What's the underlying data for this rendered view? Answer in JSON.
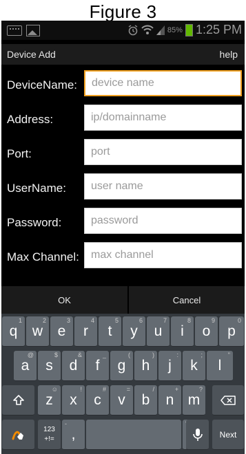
{
  "caption": "Figure 3",
  "status_bar": {
    "battery_percent": "85%",
    "time": "1:25 PM"
  },
  "app_bar": {
    "title": "Device Add",
    "help_label": "help"
  },
  "form": {
    "fields": [
      {
        "label": "DeviceName:",
        "placeholder": "device name"
      },
      {
        "label": "Address:",
        "placeholder": "ip/domainname"
      },
      {
        "label": "Port:",
        "placeholder": "port"
      },
      {
        "label": "UserName:",
        "placeholder": "user name"
      },
      {
        "label": "Password:",
        "placeholder": "password"
      },
      {
        "label": "Max Channel:",
        "placeholder": "max channel"
      }
    ]
  },
  "buttons": {
    "ok": "OK",
    "cancel": "Cancel"
  },
  "keyboard": {
    "row1": [
      {
        "k": "q",
        "s": "1"
      },
      {
        "k": "w",
        "s": "2"
      },
      {
        "k": "e",
        "s": "3"
      },
      {
        "k": "r",
        "s": "4"
      },
      {
        "k": "t",
        "s": "5"
      },
      {
        "k": "y",
        "s": "6"
      },
      {
        "k": "u",
        "s": "7"
      },
      {
        "k": "i",
        "s": "8"
      },
      {
        "k": "o",
        "s": "9"
      },
      {
        "k": "p",
        "s": "0"
      }
    ],
    "row2": [
      {
        "k": "a",
        "s": "@"
      },
      {
        "k": "s",
        "s": "$"
      },
      {
        "k": "d",
        "s": "&"
      },
      {
        "k": "f",
        "s": "_"
      },
      {
        "k": "g",
        "s": "("
      },
      {
        "k": "h",
        "s": ")"
      },
      {
        "k": "j",
        "s": ":"
      },
      {
        "k": "k",
        "s": ";"
      },
      {
        "k": "l",
        "s": "\""
      }
    ],
    "row3": [
      {
        "k": "z",
        "s": "☺"
      },
      {
        "k": "x",
        "s": "!"
      },
      {
        "k": "c",
        "s": "#"
      },
      {
        "k": "v",
        "s": "="
      },
      {
        "k": "b",
        "s": "/"
      },
      {
        "k": "n",
        "s": "+"
      },
      {
        "k": "m",
        "s": "?"
      }
    ],
    "sym_key": {
      "top": "123",
      "bottom": "+!="
    },
    "comma": {
      "k": ",",
      "s": "-"
    },
    "period": {
      "k": ".",
      "s": "'"
    },
    "next_label": "Next"
  }
}
